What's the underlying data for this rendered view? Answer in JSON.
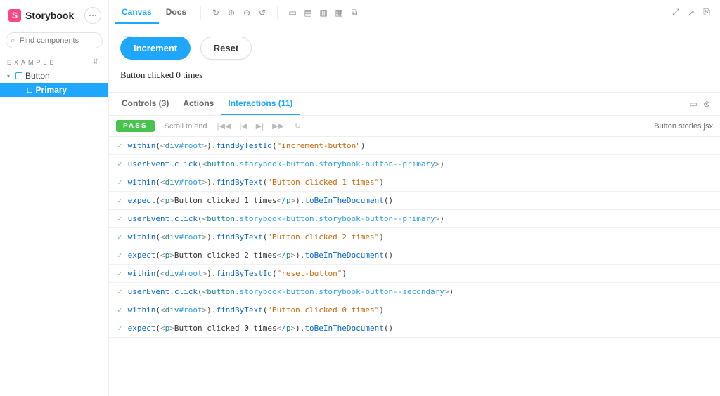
{
  "brand": {
    "logo_letter": "S",
    "name": "Storybook",
    "menu_glyph": "⋯"
  },
  "search": {
    "placeholder": "Find components",
    "shortcut": "/",
    "icon_glyph": "⌕"
  },
  "sidebar": {
    "section_label": "EXAMPLE",
    "collapse_glyph": "⇵",
    "items": [
      {
        "label": "Button",
        "kind": "component",
        "expanded": true,
        "active": false
      },
      {
        "label": "Primary",
        "kind": "story",
        "expanded": false,
        "active": true
      }
    ]
  },
  "toolbar": {
    "tabs": [
      {
        "label": "Canvas",
        "active": true
      },
      {
        "label": "Docs",
        "active": false
      }
    ],
    "icons_left": [
      "↻",
      "⊕",
      "⊖",
      "↺"
    ],
    "icons_layout": [
      "▭",
      "▤",
      "▥",
      "▦",
      "⧉"
    ],
    "icons_right": [
      "⤢",
      "↗",
      "⎘"
    ]
  },
  "canvas": {
    "buttons": {
      "increment": "Increment",
      "reset": "Reset"
    },
    "status_text": "Button clicked 0 times"
  },
  "addons": {
    "tabs": [
      {
        "label": "Controls (3)",
        "active": false
      },
      {
        "label": "Actions",
        "active": false
      },
      {
        "label": "Interactions (11)",
        "active": true
      }
    ],
    "panel_icons": [
      "▭",
      "⊗"
    ],
    "status_badge": "PASS",
    "scroll_label": "Scroll to end",
    "play_controls": [
      "|◀◀",
      "|◀",
      "▶|",
      "▶▶|",
      "↻"
    ],
    "file_label": "Button.stories.jsx"
  },
  "interactions": [
    {
      "kind": "within_findByTestId",
      "root": "#root",
      "arg": "increment-button"
    },
    {
      "kind": "userEvent_click",
      "classes": "storybook-button.storybook-button--primary"
    },
    {
      "kind": "within_findByText",
      "root": "#root",
      "arg": "Button clicked 1 times"
    },
    {
      "kind": "expect_p_toBeInTheDocument",
      "text": "Button clicked 1 times"
    },
    {
      "kind": "userEvent_click",
      "classes": "storybook-button.storybook-button--primary"
    },
    {
      "kind": "within_findByText",
      "root": "#root",
      "arg": "Button clicked 2 times"
    },
    {
      "kind": "expect_p_toBeInTheDocument",
      "text": "Button clicked 2 times"
    },
    {
      "kind": "within_findByTestId",
      "root": "#root",
      "arg": "reset-button"
    },
    {
      "kind": "userEvent_click",
      "classes": "storybook-button.storybook-button--secondary"
    },
    {
      "kind": "within_findByText",
      "root": "#root",
      "arg": "Button clicked 0 times"
    },
    {
      "kind": "expect_p_toBeInTheDocument",
      "text": "Button clicked 0 times"
    }
  ],
  "tokens": {
    "within": "within",
    "div": "div",
    "findByTestId": "findByTestId",
    "findByText": "findByText",
    "userEvent": "userEvent",
    "click": "click",
    "button": "button",
    "expect": "expect",
    "p_open": "p",
    "p_close": "/p",
    "toBeInTheDocument": "toBeInTheDocument"
  }
}
